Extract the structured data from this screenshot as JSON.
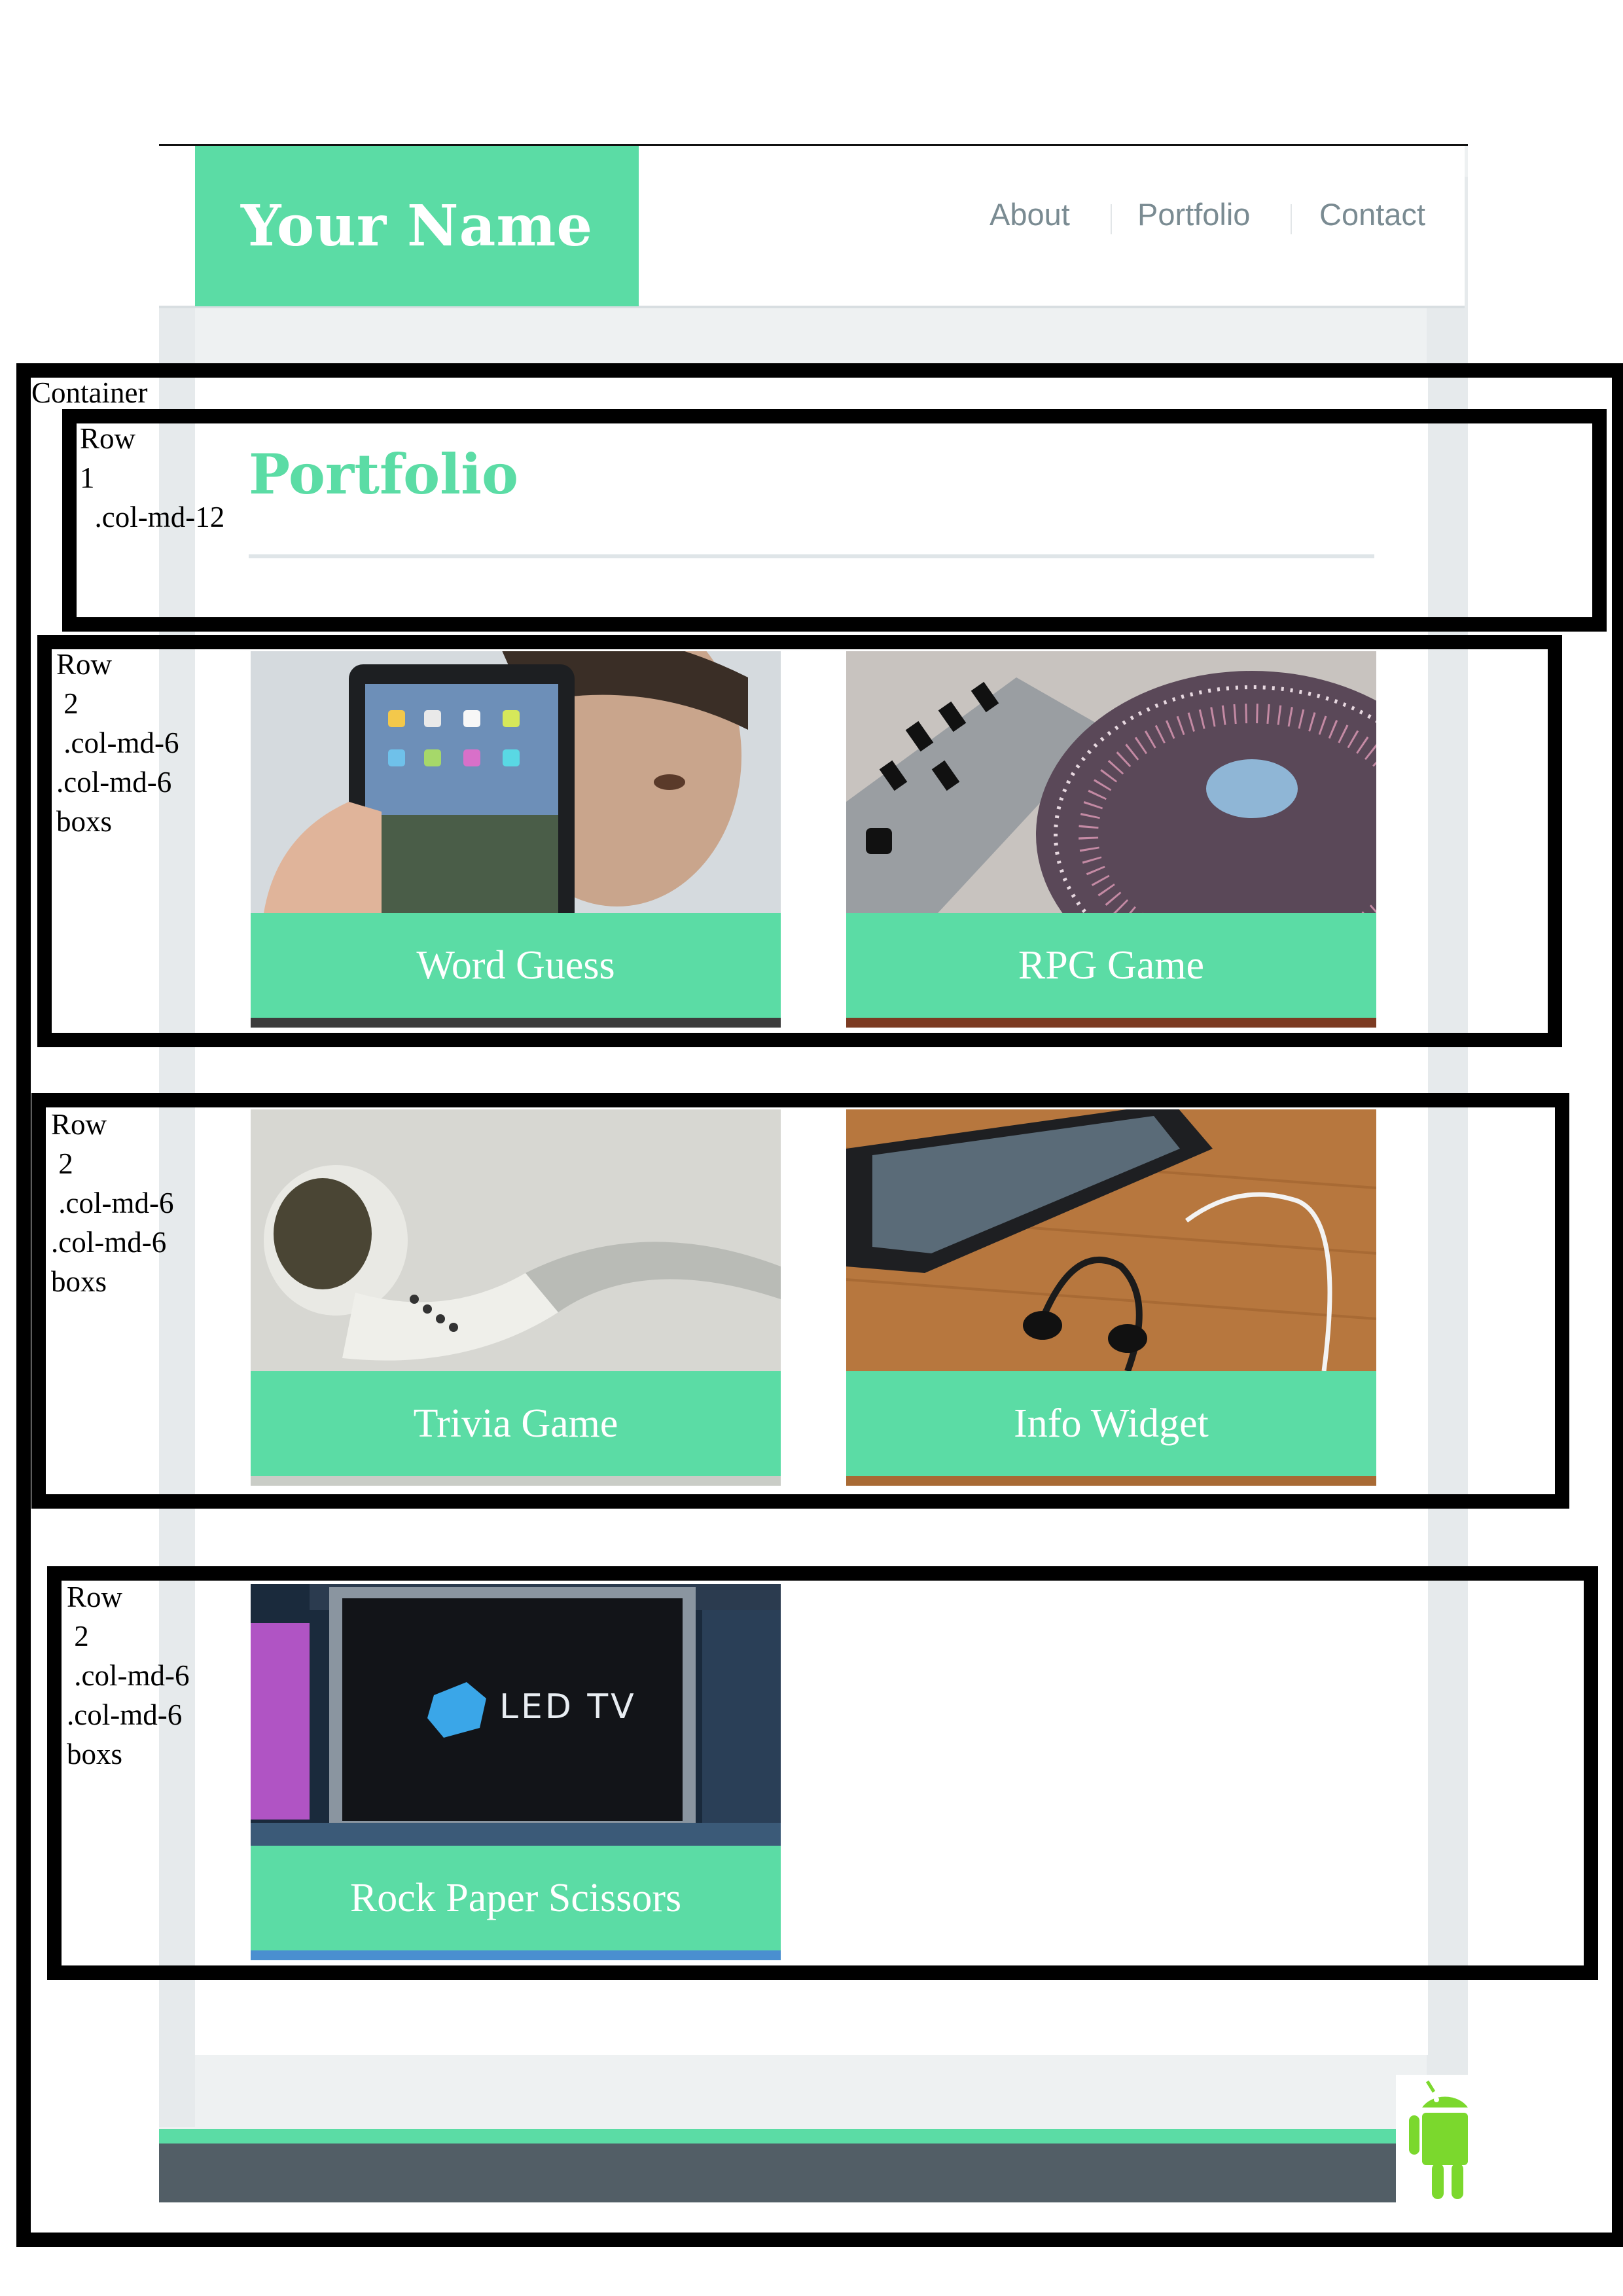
{
  "header": {
    "brand": "Your Name",
    "nav": [
      "About",
      "Portfolio",
      "Contact"
    ]
  },
  "main": {
    "title": "Portfolio",
    "projects": [
      {
        "title": "Word Guess",
        "image": "tablet-photo"
      },
      {
        "title": "RPG Game",
        "image": "turntable-photo"
      },
      {
        "title": "Trivia Game",
        "image": "earbuds-photo"
      },
      {
        "title": "Info Widget",
        "image": "phone-earphones-photo"
      },
      {
        "title": "Rock Paper Scissors",
        "image": "led-tv-photo"
      }
    ]
  },
  "annotations": {
    "container": "Container",
    "row1": "Row\n1\n  .col-md-12",
    "row2a": "Row\n 2\n .col-md-6\n.col-md-6\nboxs",
    "row2b": "Row\n 2\n .col-md-6\n.col-md-6\nboxs",
    "row2c": "Row\n 2\n .col-md-6\n.col-md-6\nboxs"
  },
  "colors": {
    "accent": "#5bdca5",
    "nav_text": "#7a8b92",
    "footer": "#525e66"
  }
}
